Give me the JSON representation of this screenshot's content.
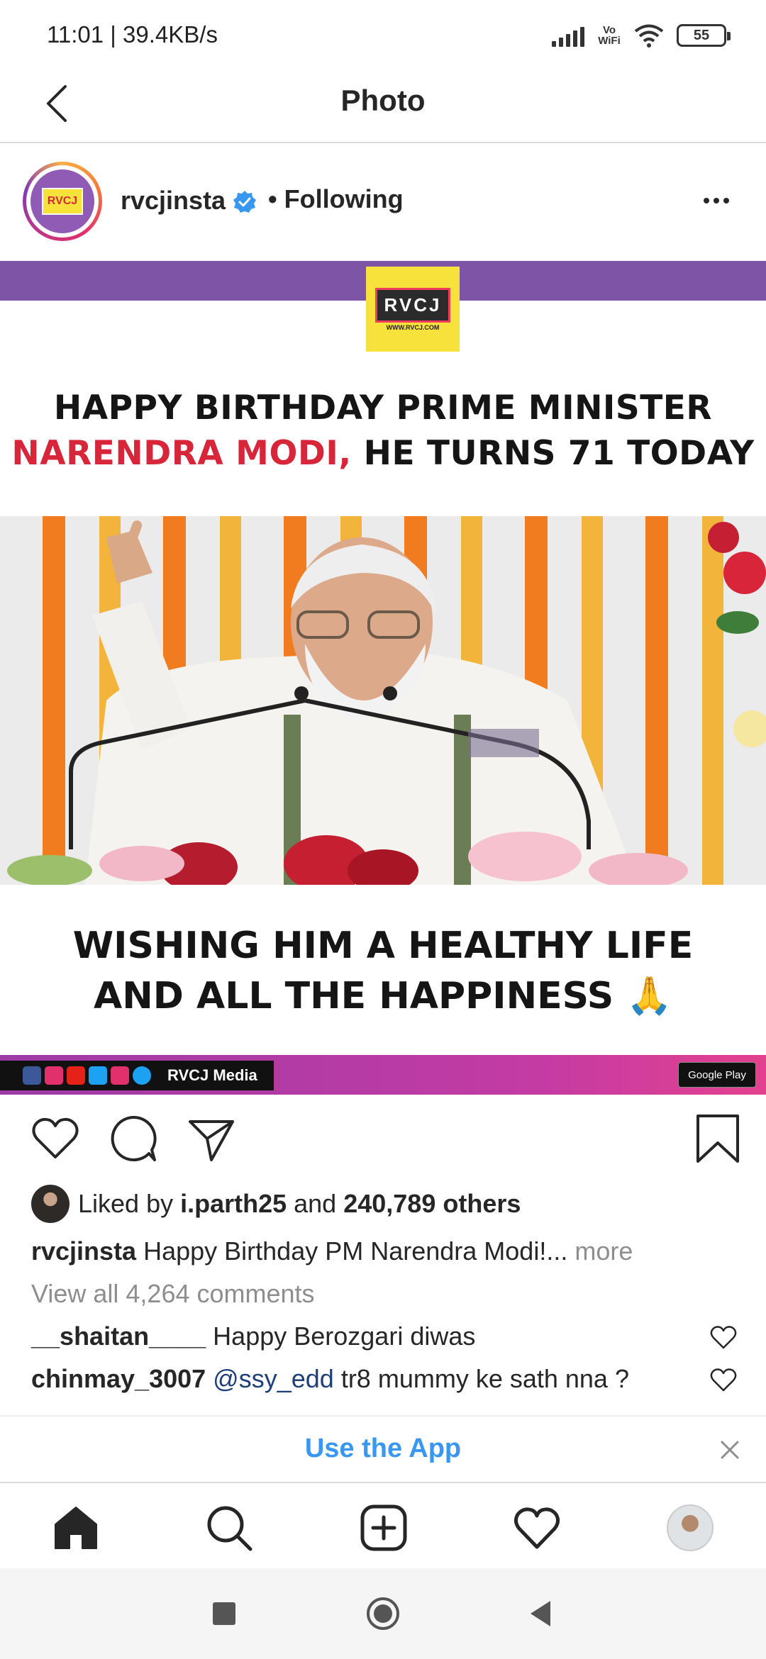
{
  "status_bar": {
    "time": "11:01 | 39.4KB/s",
    "network_label": "Vo WiFi",
    "battery": "55"
  },
  "header": {
    "title": "Photo",
    "back_icon": "chevron-left-icon"
  },
  "post": {
    "username": "rvcjinsta",
    "verified": true,
    "follow_status": "• Following",
    "avatar_text": "RVCJ",
    "image": {
      "logo_text": "RVCJ",
      "logo_subtext": "WWW.RVCJ.COM",
      "headline_line1": "HAPPY BIRTHDAY PRIME MINISTER",
      "headline_line2_red": "NARENDRA MODI,",
      "headline_line2_rest": " HE TURNS 71 TODAY",
      "wish_line1": "WISHING HIM A HEALTHY LIFE",
      "wish_line2": "AND ALL THE HAPPINESS 🙏",
      "footer_brand": "RVCJ Media",
      "store_badge": "Google Play",
      "accent_purple": "#7e55a6",
      "accent_red": "#d7263a"
    },
    "likes": {
      "prefix": "Liked by ",
      "user": "i.parth25",
      "middle": " and ",
      "count": "240,789 others"
    },
    "caption": {
      "username": "rvcjinsta",
      "text": " Happy Birthday PM Narendra Modi!...",
      "more": " more"
    },
    "view_comments": "View all 4,264 comments",
    "comments": [
      {
        "username": "__shaitan____",
        "mention": "",
        "text": " Happy Berozgari diwas"
      },
      {
        "username": "chinmay_3007",
        "mention": " @ssy_edd",
        "text": " tr8 mummy ke sath nna ?"
      }
    ]
  },
  "banner": {
    "label": "Use the App"
  },
  "tabs": [
    "home-icon",
    "search-icon",
    "new-post-icon",
    "activity-heart-icon",
    "profile-avatar"
  ]
}
